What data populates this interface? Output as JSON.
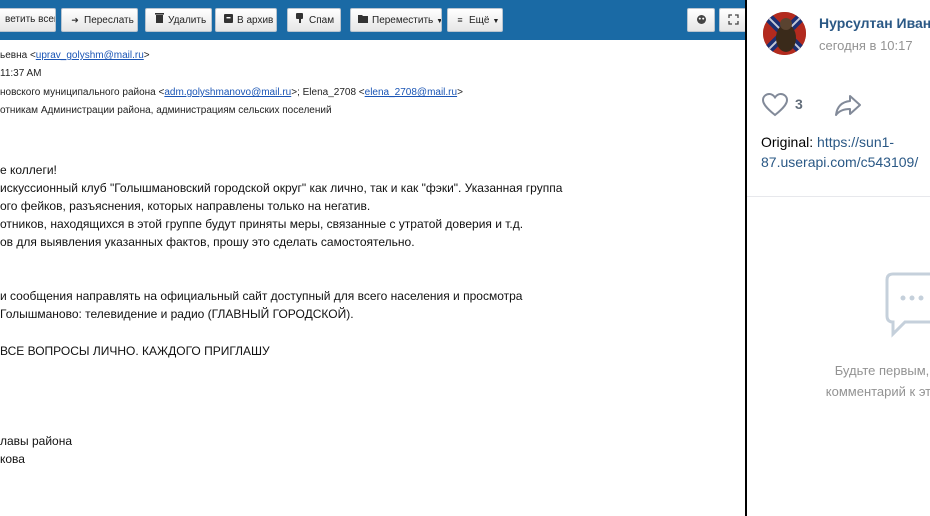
{
  "toolbar": {
    "buttons": [
      {
        "label": "ветить всем",
        "icon": "reply-all-icon"
      },
      {
        "label": "Переслать",
        "icon": "forward-arrow-icon",
        "glyph": "➜"
      },
      {
        "label": "Удалить",
        "icon": "trash-icon",
        "glyph": "🗑"
      },
      {
        "label": "В архив",
        "icon": "archive-icon",
        "glyph": "▣"
      },
      {
        "label": "Спам",
        "icon": "thumb-down-icon",
        "glyph": "✋"
      },
      {
        "label": "Переместить",
        "icon": "folder-icon",
        "glyph": "▬"
      },
      {
        "label": "Ещё",
        "icon": "menu-lines-icon",
        "glyph": "≡"
      }
    ],
    "right_icons": [
      "mask-icon",
      "expand-icon"
    ]
  },
  "email": {
    "header": {
      "from_prefix": "ьевна <",
      "from_email": "uprav_golyshm@mail.ru",
      "from_suffix": ">",
      "time": "11:37 AM",
      "to_prefix": "новского муниципального района <",
      "to_email1": "adm.golyshmanovo@mail.ru",
      "to_middle": ">; Elena_2708 <",
      "to_email2": "elena_2708@mail.ru",
      "to_suffix": ">",
      "subject": "отникам Администрации района, администрациям сельских поселений"
    },
    "body_lines": [
      "е коллеги!",
      "искуссионный клуб \"Голышмановский городской округ\" как лично, так и как \"фэки\". Указанная группа",
      "ого фейков, разъяснения,  которых направлены только на негатив.",
      "отников, находящихся в этой группе будут приняты меры, связанные с утратой доверия и т.д.",
      "ов для выявления указанных фактов, прошу это сделать самостоятельно.",
      "и сообщения направлять на официальный сайт доступный для всего населения и просмотра",
      "Голышманово: телевидение и радио (ГЛАВНЫЙ ГОРОДСКОЙ).",
      "ВСЕ ВОПРОСЫ ЛИЧНО. КАЖДОГО ПРИГЛАШУ",
      "лавы района",
      "кова"
    ]
  },
  "vk": {
    "author": "Нурсултан Иван",
    "time": "сегодня в 10:17",
    "likes": "3",
    "original_label": "Original: ",
    "original_link_line1": "https://sun1-",
    "original_link_line2": "87.userapi.com/c543109/",
    "empty_line1": "Будьте первым,",
    "empty_line2": "комментарий к это",
    "colors": {
      "link": "#2a5885",
      "muted": "#939393",
      "toolbar": "#1a6aa5"
    }
  }
}
